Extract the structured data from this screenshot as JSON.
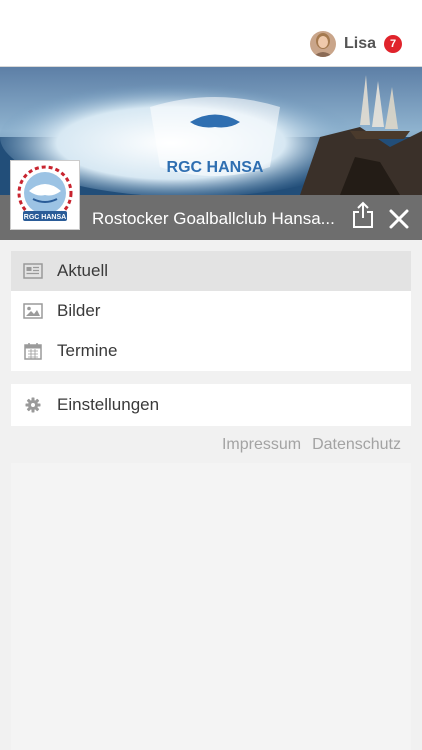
{
  "header": {
    "username": "Lisa",
    "notification_count": "7"
  },
  "banner": {
    "logo_text": "RGC HANSA"
  },
  "club": {
    "name": "Rostocker Goalballclub Hansa...",
    "logo_text": "RGC HANSA"
  },
  "menu": {
    "items": [
      {
        "label": "Aktuell",
        "icon": "newspaper-icon",
        "active": true
      },
      {
        "label": "Bilder",
        "icon": "image-icon",
        "active": false
      },
      {
        "label": "Termine",
        "icon": "calendar-icon",
        "active": false
      }
    ],
    "settings": {
      "label": "Einstellungen",
      "icon": "gear-icon"
    }
  },
  "footer_links": {
    "impressum": "Impressum",
    "datenschutz": "Datenschutz"
  },
  "colors": {
    "badge": "#e0232b",
    "titlebar": "#6e6e6e",
    "active_item": "#e3e3e3"
  }
}
